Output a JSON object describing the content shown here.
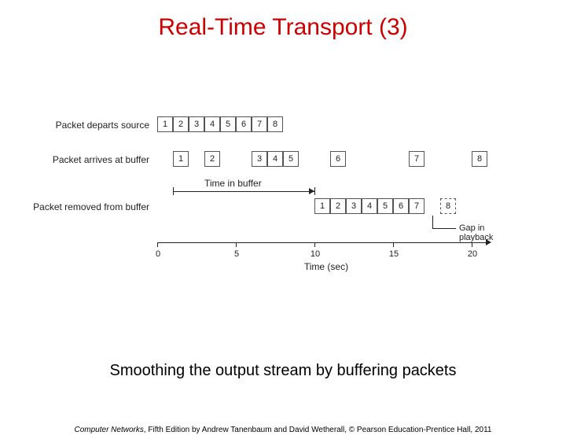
{
  "title": "Real-Time Transport (3)",
  "caption": "Smoothing the output stream by buffering packets",
  "footer": {
    "book": "Computer Networks",
    "rest": ", Fifth Edition by Andrew Tanenbaum and David Wetherall, © Pearson Education-Prentice Hall, 2011"
  },
  "diagram": {
    "rows": {
      "depart": {
        "label": "Packet departs source",
        "cells": [
          "1",
          "2",
          "3",
          "4",
          "5",
          "6",
          "7",
          "8"
        ]
      },
      "arrive": {
        "label": "Packet arrives at buffer",
        "cells": [
          "1",
          "2",
          "3",
          "4",
          "5",
          "6",
          "7",
          "8"
        ]
      },
      "remove": {
        "label": "Packet removed from buffer",
        "cells": [
          "1",
          "2",
          "3",
          "4",
          "5",
          "6",
          "7",
          "8"
        ]
      }
    },
    "time_in_buffer": "Time in buffer",
    "gap": "Gap in playback",
    "axis": {
      "label": "Time (sec)",
      "ticks": [
        "0",
        "5",
        "10",
        "15",
        "20"
      ]
    }
  },
  "chart_data": {
    "type": "table",
    "title": "Smoothing the output stream by buffering packets",
    "xlabel": "Time (sec)",
    "ylabel": "",
    "ylim": [
      0,
      21
    ],
    "series": [
      {
        "name": "Packet departs source",
        "packets": [
          1,
          2,
          3,
          4,
          5,
          6,
          7,
          8
        ],
        "start_time": [
          0,
          1,
          2,
          3,
          4,
          5,
          6,
          7
        ]
      },
      {
        "name": "Packet arrives at buffer",
        "packets": [
          1,
          2,
          3,
          4,
          5,
          6,
          7,
          8
        ],
        "start_time": [
          1,
          3,
          6,
          7,
          8,
          11,
          16,
          20
        ]
      },
      {
        "name": "Packet removed from buffer",
        "packets": [
          1,
          2,
          3,
          4,
          5,
          6,
          7,
          8
        ],
        "start_time": [
          10,
          11,
          12,
          13,
          14,
          15,
          16,
          18
        ]
      }
    ],
    "annotations": {
      "time_in_buffer_range": [
        1,
        10
      ],
      "gap_in_playback_at": 17
    }
  }
}
